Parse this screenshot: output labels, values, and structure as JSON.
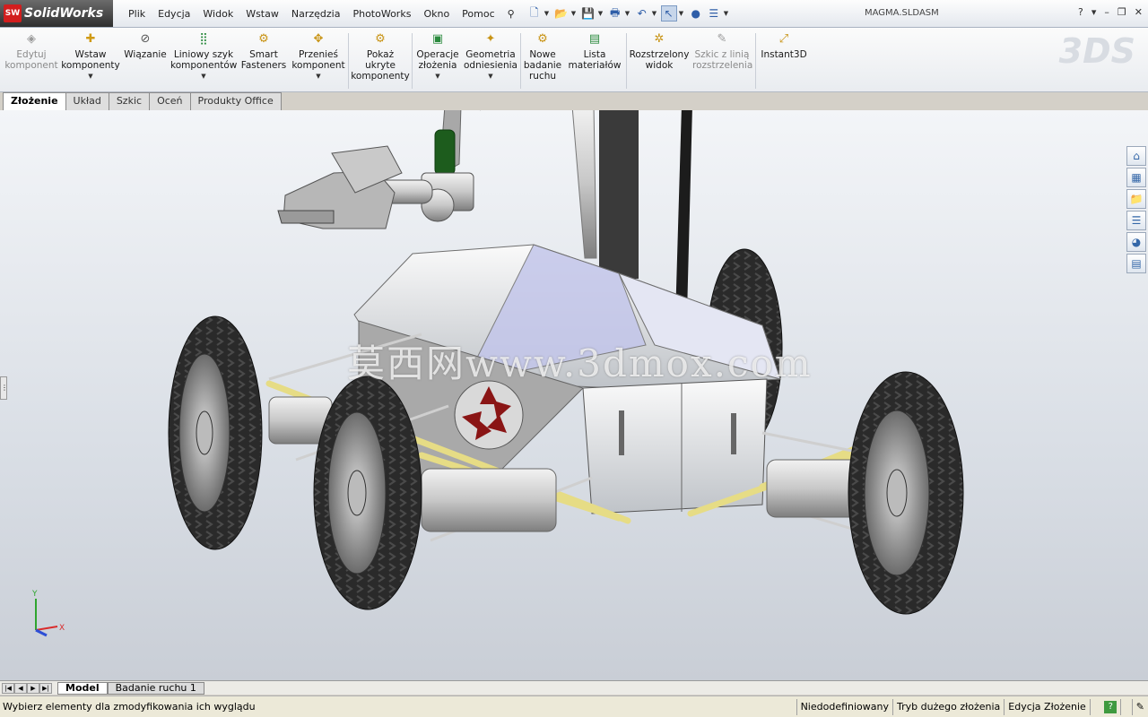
{
  "app": {
    "brand": "SolidWorks",
    "brand_short": "SW",
    "document_title": "MAGMA.SLDASM"
  },
  "menu": [
    "Plik",
    "Edycja",
    "Widok",
    "Wstaw",
    "Narzędzia",
    "PhotoWorks",
    "Okno",
    "Pomoc"
  ],
  "window_controls": {
    "help": "?",
    "minimize": "–",
    "restore": "❐",
    "close": "✕"
  },
  "commands": [
    {
      "label": "Edytuj komponent",
      "icon": "edit-component-icon",
      "glyph": "◈",
      "disabled": true
    },
    {
      "label": "Wstaw komponenty",
      "icon": "insert-components-icon",
      "glyph": "✚",
      "dropdown": true
    },
    {
      "label": "Wiązanie",
      "icon": "mate-icon",
      "glyph": "🔗"
    },
    {
      "label": "Liniowy szyk komponentów",
      "icon": "linear-pattern-icon",
      "glyph": "⣿",
      "dropdown": true
    },
    {
      "label": "Smart Fasteners",
      "icon": "smart-fasteners-icon",
      "glyph": "⚙"
    },
    {
      "label": "Przenieś komponent",
      "icon": "move-component-icon",
      "glyph": "✥",
      "dropdown": true
    },
    {
      "label": "Pokaż ukryte komponenty",
      "icon": "show-hidden-icon",
      "glyph": "👁"
    },
    {
      "label": "Operacje złożenia",
      "icon": "assembly-features-icon",
      "glyph": "▣",
      "dropdown": true
    },
    {
      "label": "Geometria odniesienia",
      "icon": "reference-geometry-icon",
      "glyph": "✦",
      "dropdown": true
    },
    {
      "label": "Nowe badanie ruchu",
      "icon": "motion-study-icon",
      "glyph": "⚙"
    },
    {
      "label": "Lista materiałów",
      "icon": "bom-icon",
      "glyph": "▤"
    },
    {
      "label": "Rozstrzelony widok",
      "icon": "exploded-view-icon",
      "glyph": "✲"
    },
    {
      "label": "Szkic z linią rozstrzelenia",
      "icon": "explode-line-sketch-icon",
      "glyph": "✎",
      "disabled": true
    },
    {
      "label": "Instant3D",
      "icon": "instant3d-icon",
      "glyph": "⤢"
    }
  ],
  "tabs": [
    {
      "label": "Złożenie",
      "active": true
    },
    {
      "label": "Układ"
    },
    {
      "label": "Szkic"
    },
    {
      "label": "Oceń"
    },
    {
      "label": "Produkty Office"
    }
  ],
  "viewport": {
    "watermark": "莫西网www.3dmox.com"
  },
  "triad": {
    "x": "X",
    "y": "Y"
  },
  "bottom_tabs": [
    {
      "label": "Model",
      "active": true
    },
    {
      "label": "Badanie ruchu 1"
    }
  ],
  "status": {
    "message": "Wybierz elementy dla zmodyfikowania ich wyglądu",
    "cells": [
      "Niedodefiniowany",
      "Tryb dużego złożenia",
      "Edycja Złożenie"
    ],
    "help": "?"
  },
  "colors": {
    "viewport_top": "#f3f5f8",
    "viewport_bottom": "#c9ced6",
    "axis_x": "#d92c2c",
    "axis_y": "#2fa52f",
    "axis_z": "#2d4fd6",
    "rod": "#e8e08a",
    "tire": "#2b2b2b"
  }
}
